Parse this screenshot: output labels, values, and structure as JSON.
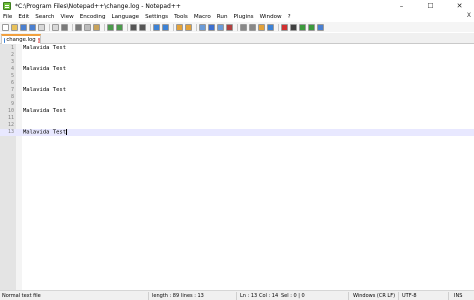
{
  "window": {
    "title": "*C:\\Program Files\\Notepad++\\change.log - Notepad++",
    "controls": [
      "–",
      "☐",
      "✕"
    ]
  },
  "menu": {
    "items": [
      "File",
      "Edit",
      "Search",
      "View",
      "Encoding",
      "Language",
      "Settings",
      "Tools",
      "Macro",
      "Run",
      "Plugins",
      "Window",
      "?"
    ],
    "close": "X"
  },
  "toolbar": {
    "icons": [
      {
        "name": "new-file-icon",
        "color": "#ffffff"
      },
      {
        "name": "open-file-icon",
        "color": "#e8c15a"
      },
      {
        "name": "save-icon",
        "color": "#4a7fd0"
      },
      {
        "name": "save-all-icon",
        "color": "#4a7fd0"
      },
      {
        "name": "close-icon",
        "color": "#d9d9d9"
      },
      {
        "name": "close-all-icon",
        "color": "#d9d9d9"
      },
      {
        "name": "print-icon",
        "color": "#7a7a7a"
      },
      {
        "name": "cut-icon",
        "color": "#7a7a7a"
      },
      {
        "name": "copy-icon",
        "color": "#bdbdbd"
      },
      {
        "name": "paste-icon",
        "color": "#c9a35a"
      },
      {
        "name": "undo-icon",
        "color": "#4b9a4b"
      },
      {
        "name": "redo-icon",
        "color": "#4b9a4b"
      },
      {
        "name": "find-icon",
        "color": "#555555"
      },
      {
        "name": "replace-icon",
        "color": "#555555"
      },
      {
        "name": "zoom-in-icon",
        "color": "#3c82d6"
      },
      {
        "name": "zoom-out-icon",
        "color": "#3c82d6"
      },
      {
        "name": "sync-vertical-icon",
        "color": "#e3a23a"
      },
      {
        "name": "sync-horizontal-icon",
        "color": "#e3a23a"
      },
      {
        "name": "word-wrap-icon",
        "color": "#6a9bd8"
      },
      {
        "name": "show-all-chars-icon",
        "color": "#3c6fd0"
      },
      {
        "name": "indent-guide-icon",
        "color": "#6a9bd8"
      },
      {
        "name": "user-lang-icon",
        "color": "#b04040"
      },
      {
        "name": "doc-map-icon",
        "color": "#888888"
      },
      {
        "name": "function-list-icon",
        "color": "#888888"
      },
      {
        "name": "folder-workspace-icon",
        "color": "#e3a23a"
      },
      {
        "name": "monitoring-icon",
        "color": "#3c82d6"
      },
      {
        "name": "record-macro-icon",
        "color": "#d03030"
      },
      {
        "name": "stop-record-icon",
        "color": "#404040"
      },
      {
        "name": "play-macro-icon",
        "color": "#3c9a3c"
      },
      {
        "name": "play-multiple-icon",
        "color": "#3c9a3c"
      },
      {
        "name": "save-macro-icon",
        "color": "#4a7fd0"
      }
    ]
  },
  "tab": {
    "label": "change.log",
    "close": "x"
  },
  "editor": {
    "lines": [
      {
        "num": "1",
        "text": "Malavida Test"
      },
      {
        "num": "2",
        "text": ""
      },
      {
        "num": "3",
        "text": ""
      },
      {
        "num": "4",
        "text": "Malavida Test"
      },
      {
        "num": "5",
        "text": ""
      },
      {
        "num": "6",
        "text": ""
      },
      {
        "num": "7",
        "text": "Malavida Test"
      },
      {
        "num": "8",
        "text": ""
      },
      {
        "num": "9",
        "text": ""
      },
      {
        "num": "10",
        "text": "Malavida Test"
      },
      {
        "num": "11",
        "text": ""
      },
      {
        "num": "12",
        "text": ""
      },
      {
        "num": "13",
        "text": "Malavida Test"
      }
    ],
    "current_line": 13
  },
  "status": {
    "file_type": "Normal text file",
    "length": "length : 89",
    "lines": "lines : 13",
    "ln": "Ln : 13",
    "col": "Col : 14",
    "sel": "Sel : 0 | 0",
    "eol": "Windows (CR LF)",
    "encoding": "UTF-8",
    "mode": "INS"
  }
}
